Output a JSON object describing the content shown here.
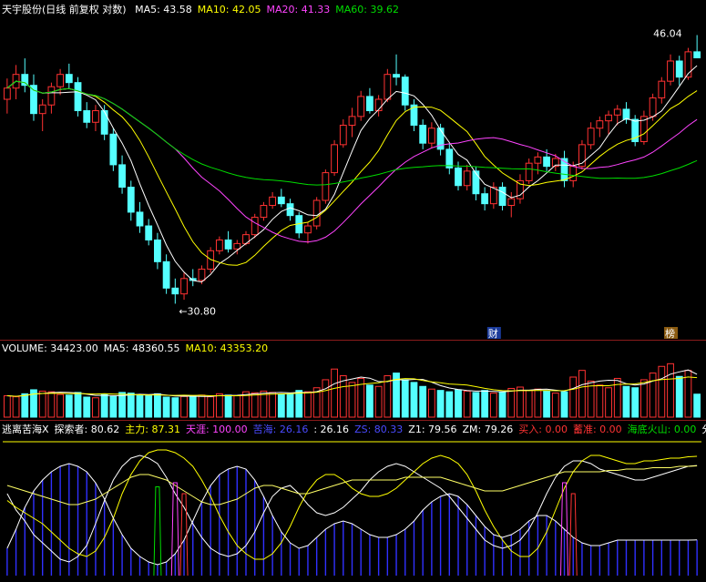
{
  "header": {
    "stock_title": "天宇股份(日线 前复权 对数)",
    "ma": [
      {
        "label": "MA5: 43.58",
        "color": "#ffffff"
      },
      {
        "label": "MA10: 42.05",
        "color": "#ffff00"
      },
      {
        "label": "MA20: 41.33",
        "color": "#ff44ff"
      },
      {
        "label": "MA60: 39.62",
        "color": "#00dd00"
      }
    ]
  },
  "volume_header": [
    {
      "label": "VOLUME: 34423.00",
      "color": "#ffffff"
    },
    {
      "label": "MA5: 48360.55",
      "color": "#ffffff"
    },
    {
      "label": "MA10: 43353.20",
      "color": "#ffff00"
    }
  ],
  "indicator_header": [
    {
      "label": "逃离苦海X",
      "color": "#ffffff"
    },
    {
      "label": "探索者: 80.62",
      "color": "#ffffff"
    },
    {
      "label": "主力: 87.31",
      "color": "#ffff00"
    },
    {
      "label": "天涯: 100.00",
      "color": "#ff44ff"
    },
    {
      "label": "苦海: 26.16",
      "color": "#4a4aff"
    },
    {
      "label": ": 26.16",
      "color": "#ffffff"
    },
    {
      "label": "ZS: 80.33",
      "color": "#4a4aff"
    },
    {
      "label": "Z1: 79.56",
      "color": "#ffffff"
    },
    {
      "label": "ZM: 79.26",
      "color": "#ffffff"
    },
    {
      "label": "买入: 0.00",
      "color": "#ff3333"
    },
    {
      "label": "蓄准: 0.00",
      "color": "#ff3333"
    },
    {
      "label": "海底火山: 0.00",
      "color": "#00dd00"
    },
    {
      "label": "分",
      "color": "#ffffff"
    }
  ],
  "badges": {
    "finance": "财",
    "rank": "榜"
  },
  "chart_data": {
    "type": "candlestick",
    "title": "天宇股份(日线 前复权 对数)",
    "y_scale": "log",
    "ylim": [
      29.5,
      49
    ],
    "annotations": {
      "high": "46.04",
      "low": "30.80"
    },
    "candles": [
      [
        43.0,
        44.5,
        42.0,
        43.8
      ],
      [
        43.8,
        45.5,
        43.0,
        44.8
      ],
      [
        44.8,
        46.0,
        43.5,
        44.0
      ],
      [
        44.0,
        44.8,
        41.5,
        42.0
      ],
      [
        42.0,
        43.0,
        40.8,
        42.6
      ],
      [
        42.6,
        44.2,
        42.0,
        43.9
      ],
      [
        43.9,
        45.2,
        43.3,
        44.8
      ],
      [
        44.8,
        45.6,
        43.8,
        44.2
      ],
      [
        44.2,
        44.6,
        41.8,
        42.2
      ],
      [
        42.2,
        42.8,
        41.0,
        41.4
      ],
      [
        41.4,
        42.6,
        40.8,
        42.2
      ],
      [
        42.2,
        42.6,
        40.2,
        40.6
      ],
      [
        40.6,
        41.0,
        38.2,
        38.6
      ],
      [
        38.6,
        39.2,
        36.8,
        37.2
      ],
      [
        37.2,
        37.6,
        35.2,
        35.7
      ],
      [
        35.7,
        36.3,
        34.5,
        34.9
      ],
      [
        34.9,
        35.3,
        33.8,
        34.1
      ],
      [
        34.1,
        34.5,
        32.5,
        32.9
      ],
      [
        32.9,
        33.3,
        31.2,
        31.5
      ],
      [
        31.5,
        32.0,
        30.7,
        31.2
      ],
      [
        31.2,
        32.3,
        30.9,
        32.0
      ],
      [
        32.0,
        32.5,
        31.6,
        31.9
      ],
      [
        31.9,
        32.7,
        31.7,
        32.5
      ],
      [
        32.5,
        33.7,
        32.3,
        33.5
      ],
      [
        33.5,
        34.3,
        33.3,
        34.1
      ],
      [
        34.1,
        34.6,
        33.4,
        33.6
      ],
      [
        33.6,
        34.1,
        33.3,
        33.9
      ],
      [
        33.9,
        34.6,
        33.8,
        34.4
      ],
      [
        34.4,
        35.6,
        34.2,
        35.4
      ],
      [
        35.4,
        36.3,
        35.2,
        36.1
      ],
      [
        36.1,
        36.9,
        35.9,
        36.6
      ],
      [
        36.6,
        37.1,
        36.0,
        36.2
      ],
      [
        36.2,
        36.5,
        35.2,
        35.5
      ],
      [
        35.5,
        35.7,
        34.2,
        34.5
      ],
      [
        34.5,
        35.1,
        33.9,
        34.9
      ],
      [
        34.9,
        36.6,
        34.7,
        36.4
      ],
      [
        36.4,
        38.3,
        36.2,
        38.1
      ],
      [
        38.1,
        40.2,
        37.9,
        39.9
      ],
      [
        39.9,
        41.6,
        39.7,
        41.2
      ],
      [
        41.2,
        42.4,
        40.4,
        41.8
      ],
      [
        41.8,
        43.6,
        41.5,
        43.2
      ],
      [
        43.2,
        43.8,
        42.0,
        42.2
      ],
      [
        42.2,
        43.3,
        41.8,
        43.0
      ],
      [
        43.0,
        45.2,
        42.8,
        44.8
      ],
      [
        44.8,
        46.3,
        44.0,
        44.6
      ],
      [
        44.6,
        44.8,
        42.2,
        42.6
      ],
      [
        42.6,
        43.0,
        40.8,
        41.2
      ],
      [
        41.2,
        41.6,
        39.6,
        40.0
      ],
      [
        40.0,
        41.4,
        39.7,
        41.0
      ],
      [
        41.0,
        41.3,
        39.2,
        39.6
      ],
      [
        39.6,
        40.0,
        38.0,
        38.4
      ],
      [
        38.4,
        38.8,
        37.0,
        37.3
      ],
      [
        37.3,
        38.6,
        37.0,
        38.2
      ],
      [
        38.2,
        38.5,
        36.4,
        36.8
      ],
      [
        36.8,
        37.2,
        35.8,
        36.2
      ],
      [
        36.2,
        37.5,
        35.9,
        37.2
      ],
      [
        37.2,
        37.5,
        35.8,
        36.1
      ],
      [
        36.1,
        36.9,
        35.4,
        36.5
      ],
      [
        36.5,
        38.0,
        36.2,
        37.6
      ],
      [
        37.6,
        39.0,
        37.4,
        38.7
      ],
      [
        38.7,
        39.4,
        38.0,
        39.1
      ],
      [
        39.1,
        39.6,
        38.2,
        38.5
      ],
      [
        38.5,
        39.3,
        38.2,
        39.0
      ],
      [
        39.0,
        39.5,
        37.2,
        37.6
      ],
      [
        37.6,
        38.8,
        37.2,
        38.5
      ],
      [
        38.5,
        40.2,
        38.3,
        39.9
      ],
      [
        39.9,
        41.4,
        39.6,
        41.0
      ],
      [
        41.0,
        41.8,
        40.4,
        41.5
      ],
      [
        41.5,
        42.2,
        40.6,
        41.9
      ],
      [
        41.9,
        42.6,
        41.2,
        42.3
      ],
      [
        42.3,
        42.8,
        41.3,
        41.6
      ],
      [
        41.6,
        41.9,
        39.8,
        40.1
      ],
      [
        40.1,
        42.2,
        39.9,
        41.8
      ],
      [
        41.8,
        43.4,
        41.5,
        43.1
      ],
      [
        43.1,
        44.6,
        42.7,
        44.3
      ],
      [
        44.3,
        46.3,
        44.0,
        45.8
      ],
      [
        45.8,
        46.2,
        44.0,
        44.6
      ],
      [
        44.6,
        46.8,
        44.4,
        46.5
      ],
      [
        46.5,
        47.8,
        46.2,
        46.04
      ]
    ],
    "ma_lines": [
      "MA5",
      "MA10",
      "MA20",
      "MA60"
    ],
    "volume": {
      "series_name": "VOLUME",
      "values": [
        32000,
        30500,
        35000,
        41000,
        39000,
        38000,
        34000,
        33000,
        37000,
        30000,
        29000,
        34000,
        31000,
        37000,
        36000,
        33000,
        32000,
        35000,
        30000,
        29000,
        31000,
        31500,
        33000,
        30500,
        35000,
        33000,
        32000,
        38000,
        36500,
        39000,
        37000,
        34000,
        35000,
        40000,
        38000,
        44000,
        56000,
        72000,
        62000,
        52000,
        58000,
        48000,
        46000,
        62000,
        66000,
        56000,
        52000,
        46000,
        42000,
        40000,
        38000,
        41000,
        39000,
        37000,
        40000,
        36000,
        38000,
        43000,
        45000,
        40000,
        42000,
        39000,
        36000,
        38000,
        60000,
        70000,
        54000,
        48000,
        44000,
        58000,
        46000,
        44000,
        56000,
        66000,
        76000,
        80000,
        61000,
        70000,
        34423
      ],
      "ylim": [
        0,
        90000
      ]
    },
    "indicator": {
      "name": "逃离苦海X",
      "ylim": [
        0,
        100
      ],
      "series": [
        {
          "name": "探索者",
          "values": [
            60,
            48,
            40,
            30,
            24,
            18,
            12,
            10,
            14,
            22,
            38,
            55,
            70,
            80,
            86,
            88,
            86,
            82,
            72,
            60,
            50,
            38,
            28,
            20,
            16,
            14,
            16,
            22,
            32,
            46,
            58,
            64,
            66,
            60,
            52,
            46,
            44,
            46,
            50,
            56,
            62,
            70,
            76,
            80,
            82,
            80,
            76,
            72,
            68,
            64,
            58,
            50,
            42,
            34,
            26,
            22,
            20,
            22,
            26,
            34,
            46,
            60,
            72,
            80,
            84,
            84,
            82,
            78,
            76,
            74,
            72,
            70,
            70,
            72,
            74,
            76,
            78,
            80,
            80.62
          ]
        },
        {
          "name": "主力",
          "values": [
            55,
            50,
            46,
            42,
            38,
            32,
            26,
            20,
            16,
            14,
            18,
            28,
            42,
            60,
            74,
            84,
            90,
            92,
            92,
            90,
            86,
            80,
            70,
            58,
            44,
            32,
            22,
            16,
            12,
            12,
            16,
            24,
            36,
            50,
            62,
            70,
            74,
            74,
            70,
            64,
            60,
            58,
            58,
            60,
            64,
            70,
            76,
            82,
            86,
            88,
            86,
            82,
            74,
            62,
            48,
            36,
            26,
            18,
            14,
            14,
            20,
            32,
            48,
            64,
            76,
            84,
            88,
            88,
            86,
            84,
            82,
            82,
            84,
            84,
            85,
            86,
            86,
            87,
            87.31
          ]
        },
        {
          "name": "苦海",
          "values": [
            20,
            34,
            50,
            62,
            70,
            76,
            80,
            82,
            80,
            76,
            68,
            56,
            42,
            30,
            20,
            14,
            10,
            8,
            10,
            16,
            26,
            40,
            54,
            66,
            74,
            78,
            80,
            78,
            70,
            58,
            44,
            32,
            24,
            20,
            22,
            28,
            34,
            38,
            40,
            38,
            34,
            30,
            28,
            28,
            30,
            34,
            40,
            48,
            54,
            58,
            60,
            58,
            52,
            44,
            36,
            30,
            28,
            30,
            34,
            40,
            44,
            44,
            40,
            34,
            28,
            24,
            22,
            22,
            24,
            26,
            26,
            26,
            26,
            26,
            26,
            26,
            26,
            26,
            26.16
          ]
        },
        {
          "name": "ZS",
          "values": [
            66,
            64,
            62,
            60,
            58,
            56,
            54,
            52,
            52,
            54,
            56,
            60,
            64,
            68,
            72,
            74,
            74,
            72,
            70,
            66,
            62,
            58,
            54,
            52,
            52,
            54,
            56,
            60,
            64,
            66,
            66,
            64,
            62,
            60,
            60,
            62,
            64,
            66,
            68,
            70,
            70,
            70,
            70,
            70,
            70,
            72,
            72,
            72,
            72,
            72,
            70,
            68,
            66,
            64,
            62,
            62,
            62,
            64,
            66,
            68,
            70,
            72,
            74,
            76,
            76,
            76,
            76,
            76,
            77,
            77,
            78,
            78,
            78,
            79,
            79,
            79,
            80,
            80,
            80.33
          ]
        }
      ],
      "bars": {
        "name": "苦海",
        "values": [
          20,
          34,
          50,
          62,
          70,
          76,
          80,
          82,
          80,
          76,
          68,
          56,
          42,
          30,
          20,
          14,
          10,
          8,
          10,
          16,
          26,
          40,
          54,
          66,
          74,
          78,
          80,
          78,
          70,
          58,
          44,
          32,
          24,
          20,
          22,
          28,
          34,
          38,
          40,
          38,
          34,
          30,
          28,
          28,
          30,
          34,
          40,
          48,
          54,
          58,
          60,
          58,
          52,
          44,
          36,
          30,
          28,
          30,
          34,
          40,
          44,
          44,
          40,
          34,
          28,
          24,
          22,
          22,
          24,
          26,
          26,
          26,
          26,
          26,
          26,
          26,
          26,
          26,
          26.16
        ]
      },
      "signals": [
        {
          "index": 17,
          "value": 65,
          "color": "#00dd00"
        },
        {
          "index": 19,
          "value": 68,
          "color": "#ff44ff"
        },
        {
          "index": 20,
          "value": 60,
          "color": "#ff3333"
        },
        {
          "index": 63,
          "value": 68,
          "color": "#ff44ff"
        },
        {
          "index": 64,
          "value": 60,
          "color": "#ff3333"
        }
      ]
    }
  }
}
